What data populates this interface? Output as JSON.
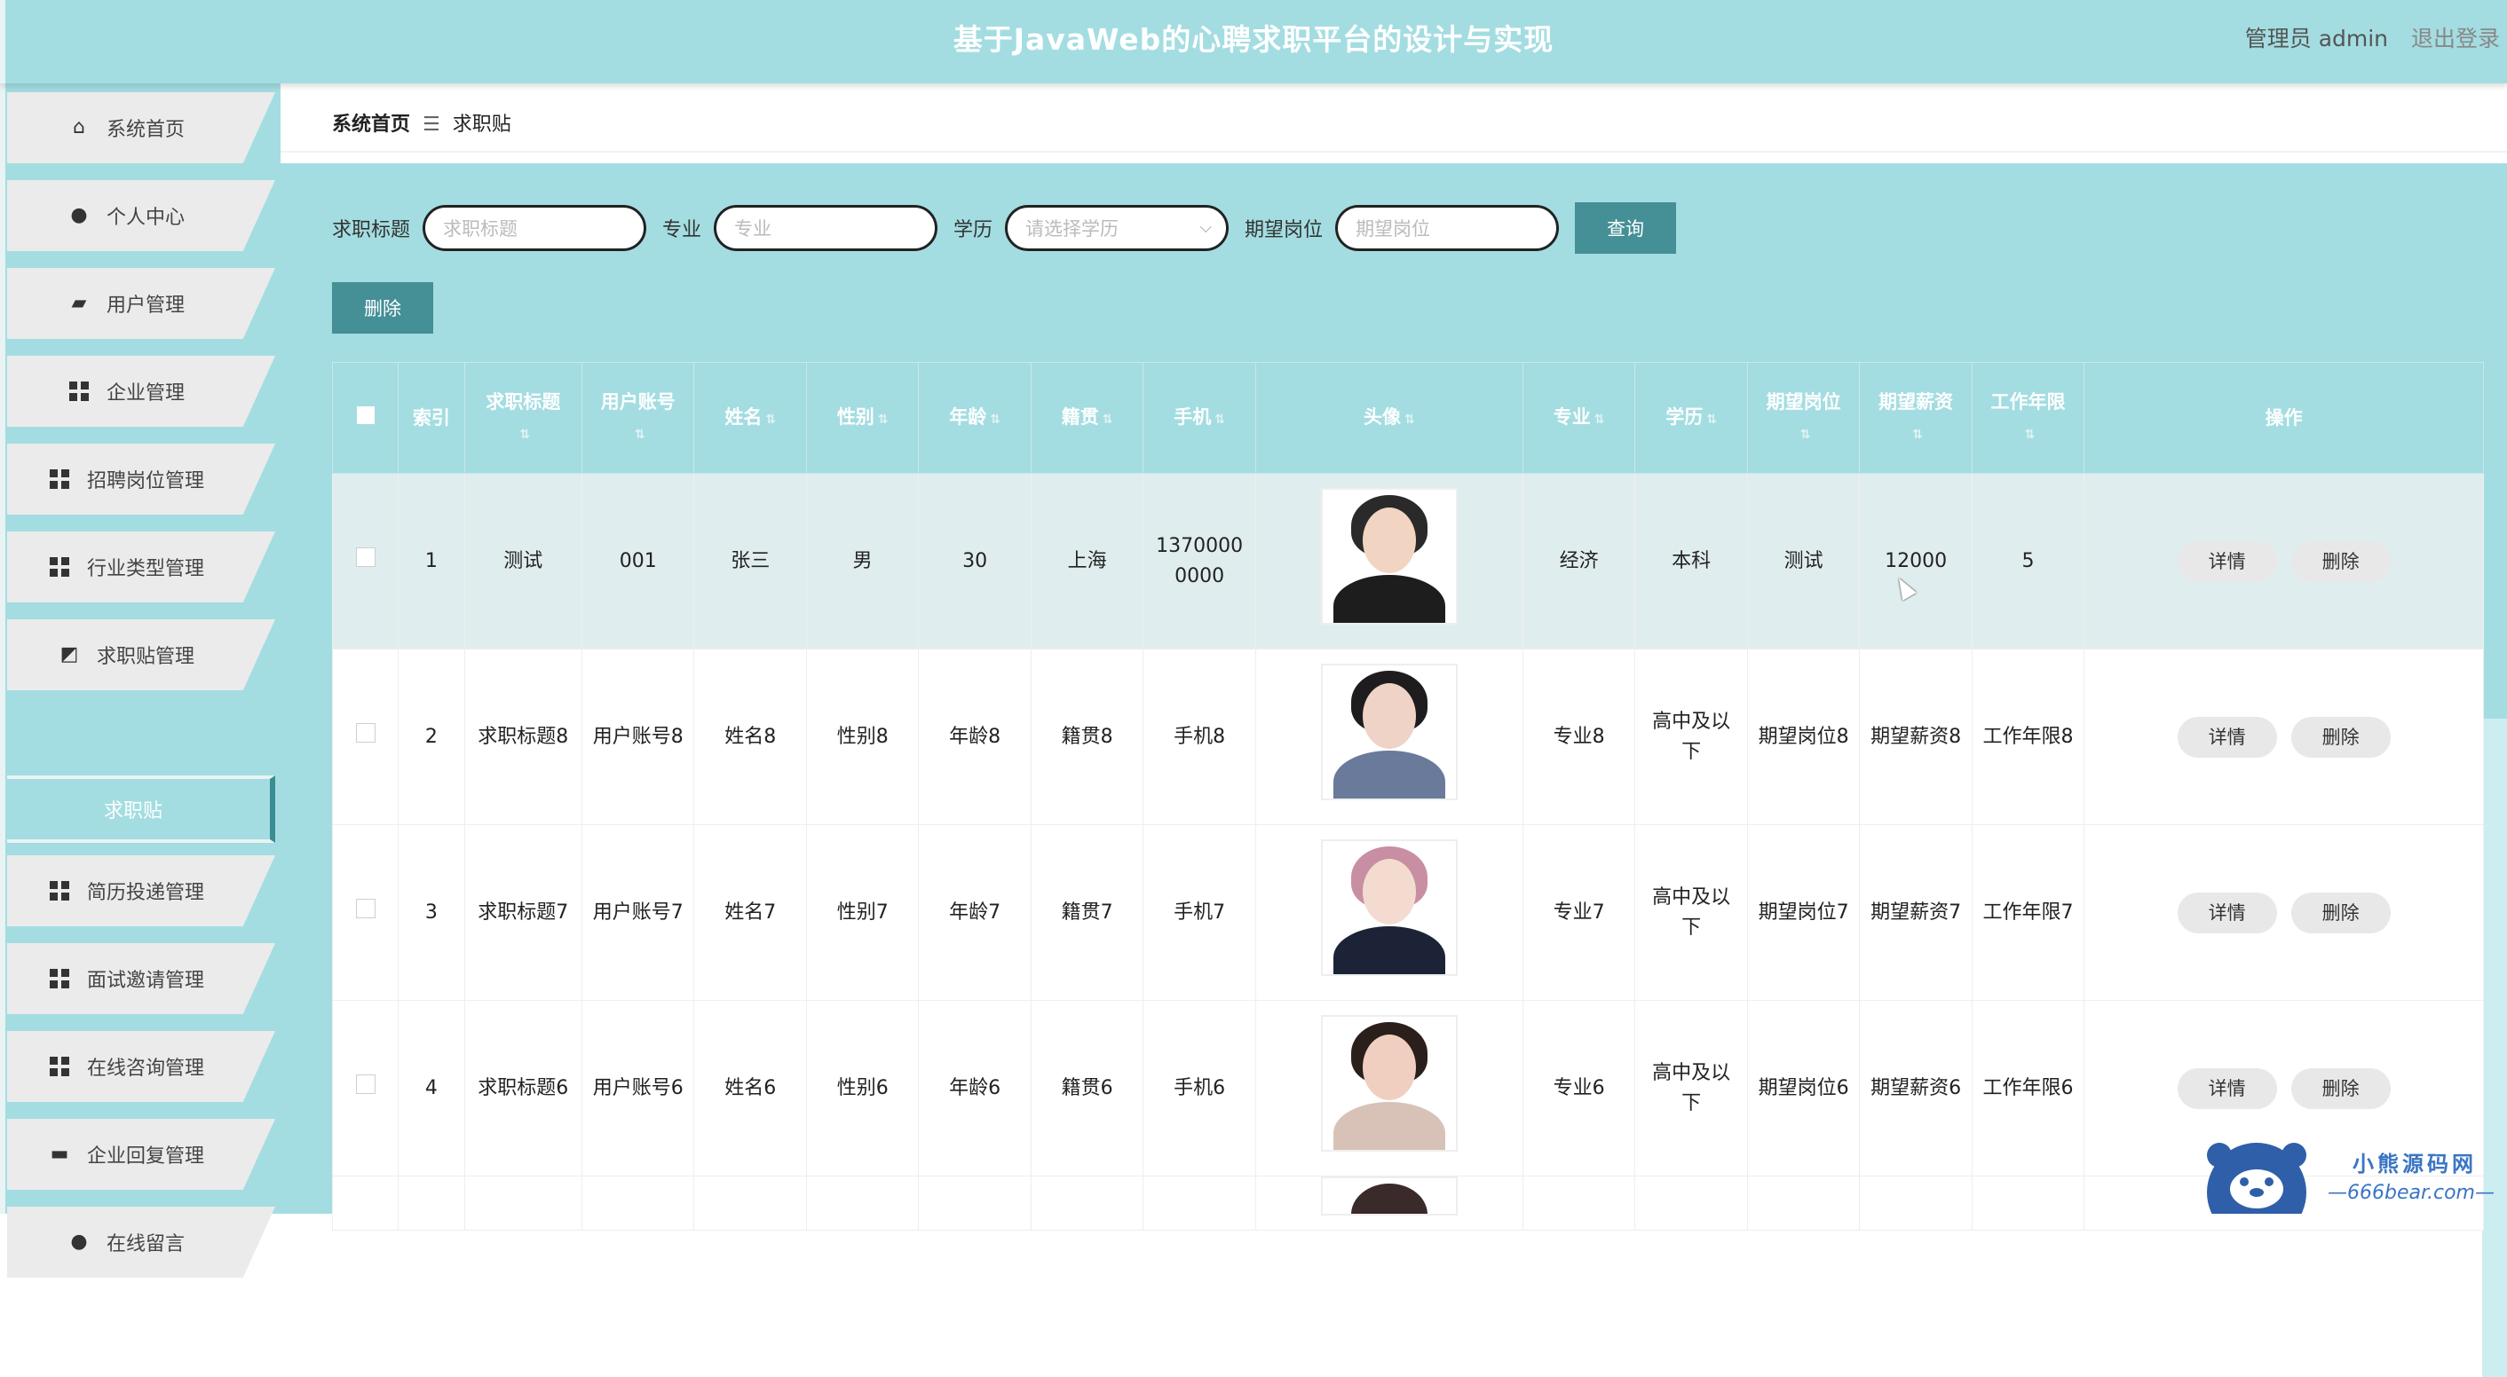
{
  "header": {
    "title": "基于JavaWeb的心聘求职平台的设计与实现",
    "user_label": "管理员 admin",
    "logout_label": "退出登录",
    "colors": {
      "accent": "#a3dde1",
      "button": "#458f96"
    }
  },
  "sidebar": {
    "items": [
      {
        "label": "系统首页",
        "icon": "home-icon"
      },
      {
        "label": "个人中心",
        "icon": "person-icon"
      },
      {
        "label": "用户管理",
        "icon": "wallet-icon"
      },
      {
        "label": "企业管理",
        "icon": "grid-icon"
      },
      {
        "label": "招聘岗位管理",
        "icon": "grid-icon"
      },
      {
        "label": "行业类型管理",
        "icon": "grid-icon"
      },
      {
        "label": "求职贴管理",
        "icon": "chart-icon"
      },
      {
        "label": "简历投递管理",
        "icon": "grid-icon"
      },
      {
        "label": "面试邀请管理",
        "icon": "grid-icon"
      },
      {
        "label": "在线咨询管理",
        "icon": "grid-icon"
      },
      {
        "label": "企业回复管理",
        "icon": "chat-icon"
      },
      {
        "label": "在线留言",
        "icon": "person-icon"
      }
    ],
    "active_sub": "求职贴"
  },
  "breadcrumb": {
    "home": "系统首页",
    "separator": "☰",
    "current": "求职贴"
  },
  "search": {
    "title_label": "求职标题",
    "title_placeholder": "求职标题",
    "major_label": "专业",
    "major_placeholder": "专业",
    "edu_label": "学历",
    "edu_placeholder": "请选择学历",
    "position_label": "期望岗位",
    "position_placeholder": "期望岗位",
    "query_label": "查询",
    "delete_label": "删除"
  },
  "table": {
    "headers": [
      "索引",
      "求职标题",
      "用户账号",
      "姓名",
      "性别",
      "年龄",
      "籍贯",
      "手机",
      "头像",
      "专业",
      "学历",
      "期望岗位",
      "期望薪资",
      "工作年限",
      "操作"
    ],
    "rows": [
      {
        "index": "1",
        "title": "测试",
        "account": "001",
        "name": "张三",
        "gender": "男",
        "age": "30",
        "origin": "上海",
        "phone": "13700000000",
        "major": "经济",
        "edu": "本科",
        "position": "测试",
        "salary": "12000",
        "years": "5"
      },
      {
        "index": "2",
        "title": "求职标题8",
        "account": "用户账号8",
        "name": "姓名8",
        "gender": "性别8",
        "age": "年龄8",
        "origin": "籍贯8",
        "phone": "手机8",
        "major": "专业8",
        "edu": "高中及以下",
        "position": "期望岗位8",
        "salary": "期望薪资8",
        "years": "工作年限8"
      },
      {
        "index": "3",
        "title": "求职标题7",
        "account": "用户账号7",
        "name": "姓名7",
        "gender": "性别7",
        "age": "年龄7",
        "origin": "籍贯7",
        "phone": "手机7",
        "major": "专业7",
        "edu": "高中及以下",
        "position": "期望岗位7",
        "salary": "期望薪资7",
        "years": "工作年限7"
      },
      {
        "index": "4",
        "title": "求职标题6",
        "account": "用户账号6",
        "name": "姓名6",
        "gender": "性别6",
        "age": "年龄6",
        "origin": "籍贯6",
        "phone": "手机6",
        "major": "专业6",
        "edu": "高中及以下",
        "position": "期望岗位6",
        "salary": "期望薪资6",
        "years": "工作年限6"
      }
    ],
    "detail_label": "详情",
    "delete_label": "删除"
  },
  "watermark": {
    "name": "小熊源码网",
    "url": "—666bear.com—"
  }
}
